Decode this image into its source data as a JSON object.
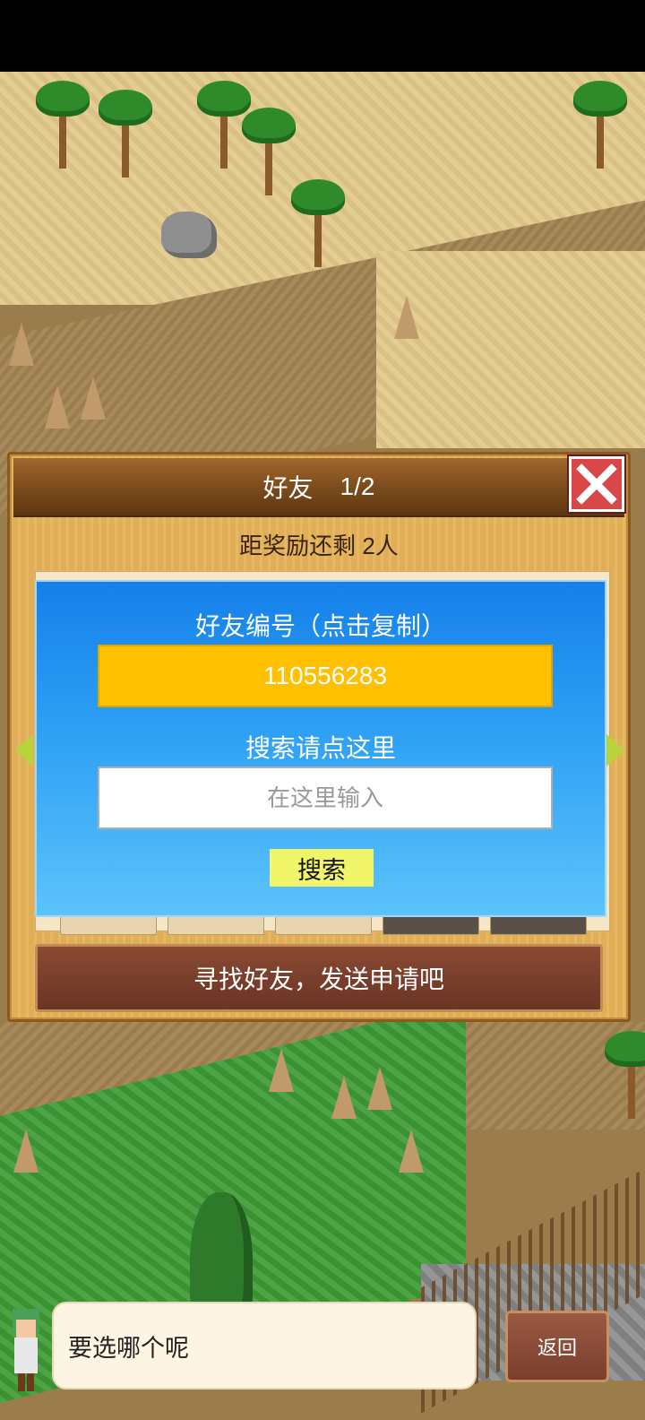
{
  "dialog": {
    "title": "好友",
    "page": "1/2",
    "reward_text": "距奖励还剩 2人",
    "friend_id_label": "好友编号（点击复制）",
    "friend_id": "110556283",
    "search_hint": "搜索请点这里",
    "search_placeholder": "在这里输入",
    "search_button": "搜索",
    "action_text": "寻找好友，发送申请吧"
  },
  "footer": {
    "message": "要选哪个呢",
    "back_button": "返回"
  },
  "icons": {
    "close": "close-icon",
    "prev": "arrow-left-icon",
    "next": "arrow-right-icon"
  },
  "colors": {
    "id_box": "#ffc000",
    "search_button": "#f0f56a",
    "close": "#d94848",
    "nav_arrows": "#b7d43b"
  }
}
